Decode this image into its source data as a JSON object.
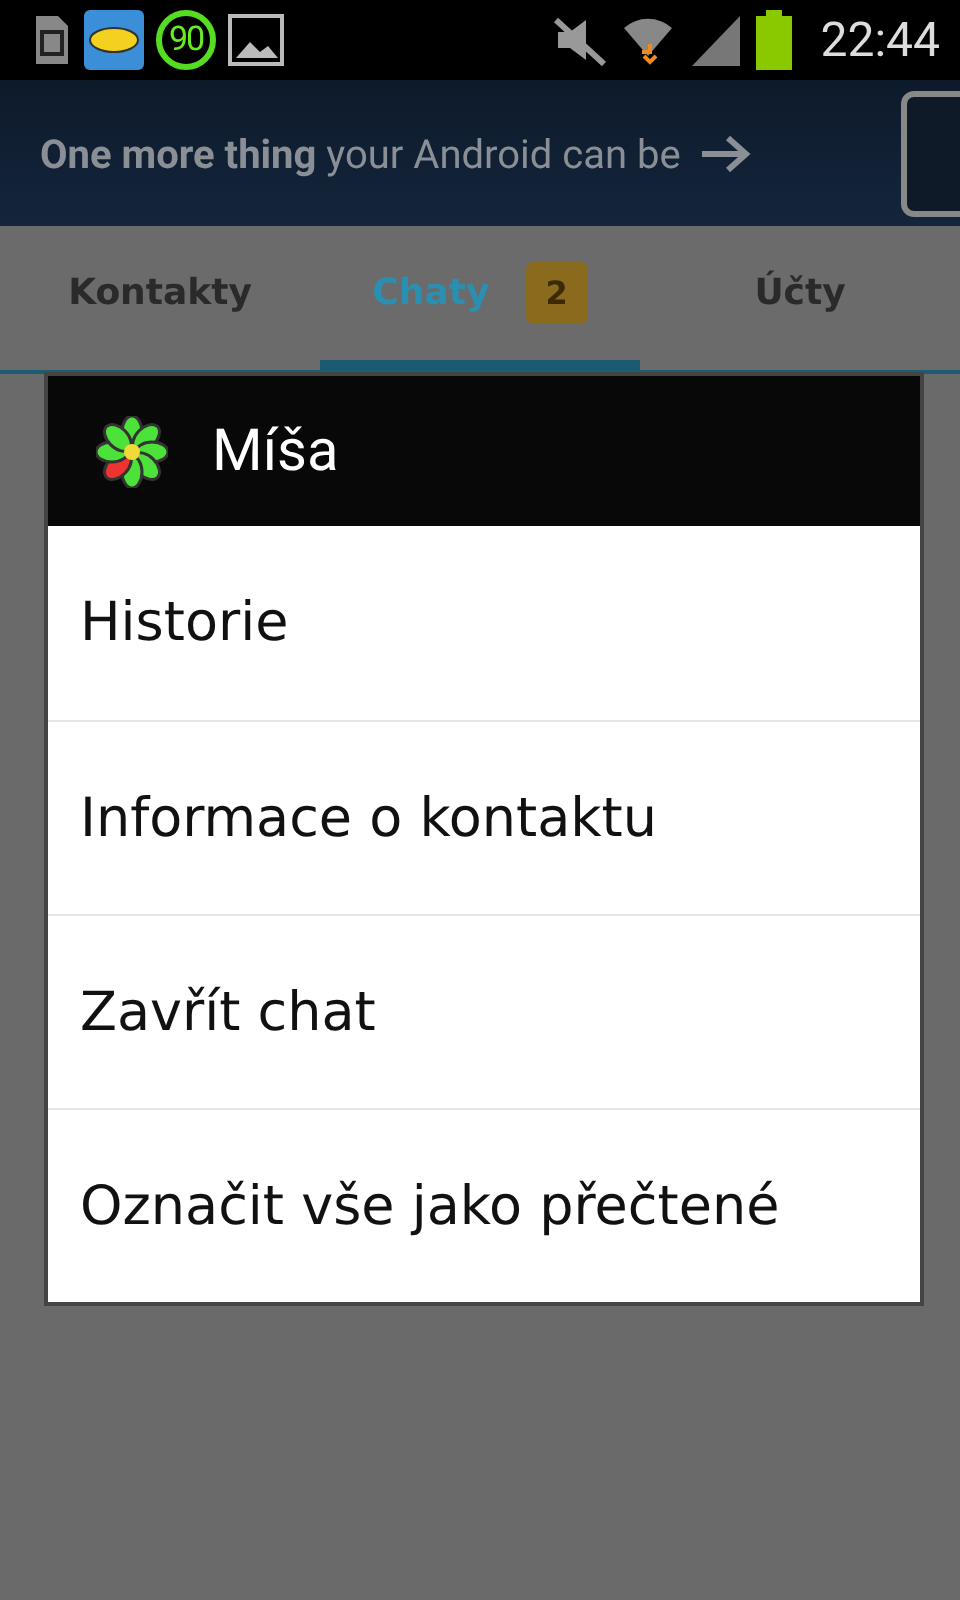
{
  "status_bar": {
    "download_count": "90",
    "time": "22:44"
  },
  "banner": {
    "bold_text": "One more thing",
    "text": "your Android can be"
  },
  "tabs": [
    {
      "label": "Kontakty",
      "selected": false
    },
    {
      "label": "Chaty",
      "selected": true,
      "badge": "2"
    },
    {
      "label": "Účty",
      "selected": false
    }
  ],
  "dialog": {
    "title": "Míša",
    "items": [
      "Historie",
      "Informace o kontaktu",
      "Zavřít chat",
      "Označit vše jako přečtené"
    ]
  }
}
